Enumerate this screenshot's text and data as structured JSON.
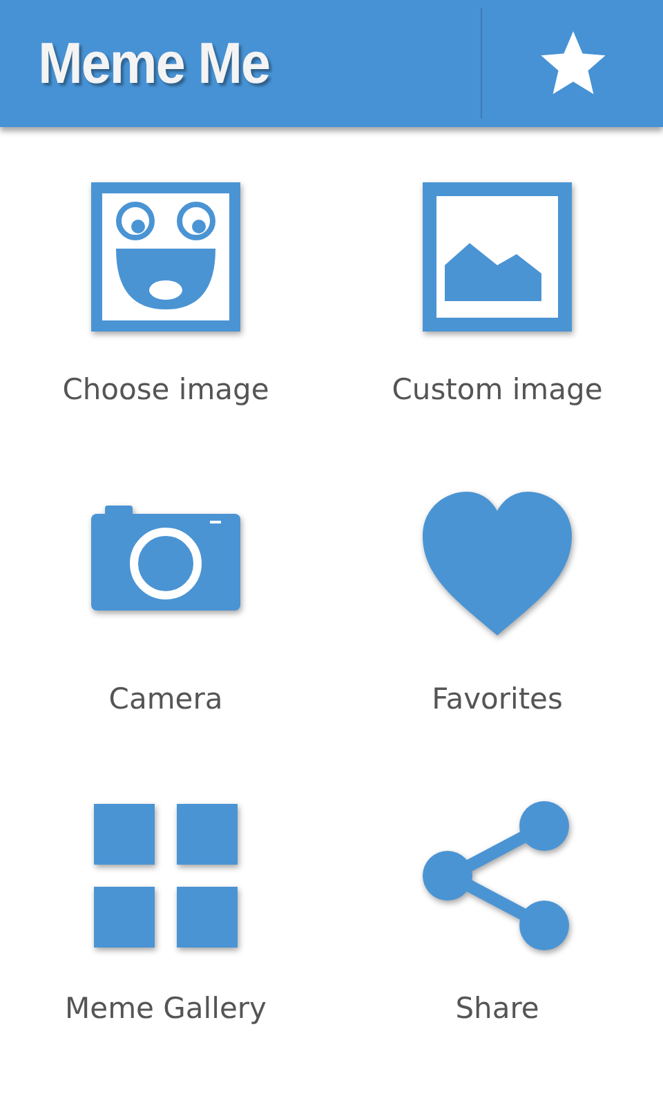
{
  "app_bar": {
    "title": "Meme Me"
  },
  "items": [
    {
      "label": "Choose image",
      "kind": "face"
    },
    {
      "label": "Custom image",
      "kind": "picture"
    },
    {
      "label": "Camera",
      "kind": "camera"
    },
    {
      "label": "Favorites",
      "kind": "heart"
    },
    {
      "label": "Meme Gallery",
      "kind": "grid"
    },
    {
      "label": "Share",
      "kind": "share"
    }
  ]
}
